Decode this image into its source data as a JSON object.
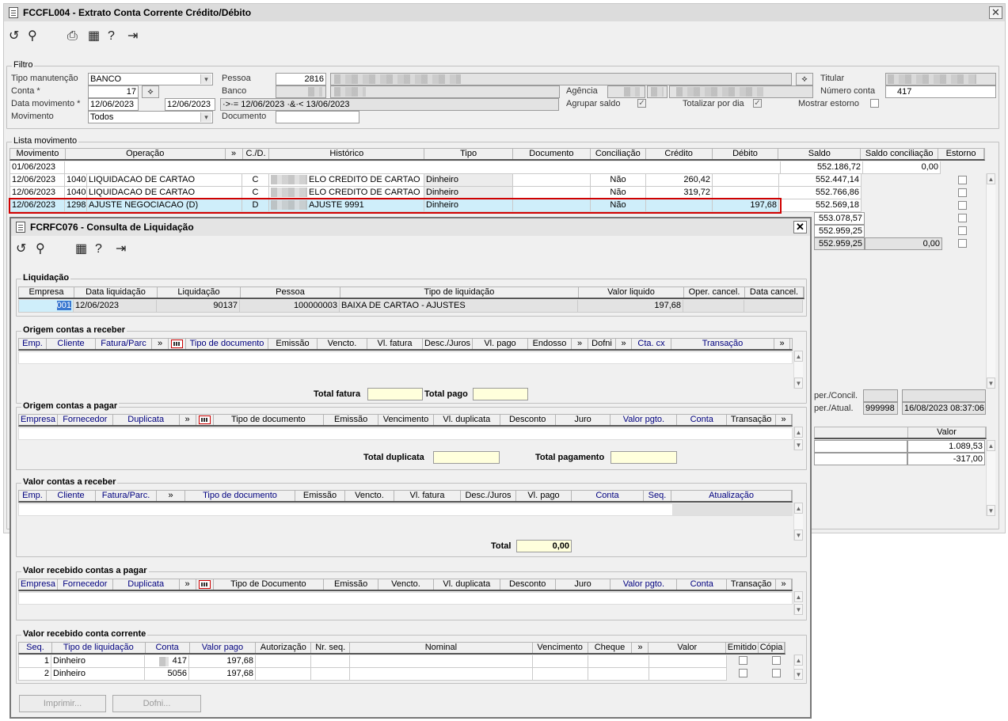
{
  "main_window": {
    "title": "FCCFL004 - Extrato Conta Corrente Crédito/Débito",
    "toolbar": [
      "refresh-icon",
      "search-icon",
      "print-icon",
      "calendar-icon",
      "help-icon",
      "exit-icon"
    ],
    "filtro": {
      "legend": "Filtro",
      "tipo_manutencao_label": "Tipo manutenção",
      "tipo_manutencao_value": "BANCO",
      "conta_label": "Conta *",
      "conta_value": "17",
      "data_mov_label": "Data movimento *",
      "data_ini": "12/06/2023",
      "data_fim": "12/06/2023",
      "data_expr": "·>·= 12/06/2023 ·&·< 13/06/2023",
      "movimento_label": "Movimento",
      "movimento_value": "Todos",
      "pessoa_label": "Pessoa",
      "pessoa_value": "2816",
      "banco_label": "Banco",
      "documento_label": "Documento",
      "agencia_label": "Agência",
      "titular_label": "Titular",
      "numero_conta_label": "Número conta",
      "numero_conta_value": "417",
      "agrupar_saldo_label": "Agrupar saldo",
      "agrupar_saldo_checked": "✓",
      "totalizar_dia_label": "Totalizar por dia",
      "totalizar_dia_checked": "✓",
      "mostrar_estorno_label": "Mostrar estorno"
    },
    "lista": {
      "legend": "Lista movimento",
      "headers": [
        "Movimento",
        "Operação",
        "»",
        "C./D.",
        "Histórico",
        "Tipo",
        "Documento",
        "Conciliação",
        "Crédito",
        "Débito",
        "Saldo",
        "Saldo conciliação",
        "Estorno"
      ],
      "rows": [
        {
          "mov": "01/06/2023",
          "op_cod": "",
          "op": "",
          "cd": "",
          "hist": "",
          "tipo": "",
          "doc": "",
          "conc": "",
          "cred": "",
          "deb": "",
          "saldo": "552.186,72",
          "saldo_conc": "0,00"
        },
        {
          "mov": "12/06/2023",
          "op_cod": "1040",
          "op": "LIQUIDACAO DE CARTAO",
          "cd": "C",
          "hist": "ELO CREDITO DE CARTAO",
          "tipo": "Dinheiro",
          "doc": "",
          "conc": "Não",
          "cred": "260,42",
          "deb": "",
          "saldo": "552.447,14",
          "saldo_conc": ""
        },
        {
          "mov": "12/06/2023",
          "op_cod": "1040",
          "op": "LIQUIDACAO DE CARTAO",
          "cd": "C",
          "hist": "ELO CREDITO DE CARTAO",
          "tipo": "Dinheiro",
          "doc": "",
          "conc": "Não",
          "cred": "319,72",
          "deb": "",
          "saldo": "552.766,86",
          "saldo_conc": ""
        },
        {
          "mov": "12/06/2023",
          "op_cod": "1298",
          "op": "AJUSTE NEGOCIACAO (D)",
          "cd": "D",
          "hist": "AJUSTE 9991",
          "tipo": "Dinheiro",
          "doc": "",
          "conc": "Não",
          "cred": "",
          "deb": "197,68",
          "saldo": "552.569,18",
          "saldo_conc": ""
        }
      ],
      "extra_saldos": [
        "553.078,57",
        "552.959,25",
        "552.959,25"
      ],
      "extra_saldo_conc": "0,00"
    },
    "side": {
      "oper_concil_label": "per./Concil.",
      "oper_atual_label": "per./Atual.",
      "oper_atual_user": "999998",
      "oper_atual_date": "16/08/2023 08:37:06",
      "valor_header": "Valor",
      "valores": [
        "1.089,53",
        "-317,00"
      ]
    }
  },
  "dialog": {
    "title": "FCRFC076 - Consulta de Liquidação",
    "toolbar": [
      "refresh-icon",
      "search-icon",
      "calendar-icon",
      "help-icon",
      "exit-icon"
    ],
    "liquidacao": {
      "legend": "Liquidação",
      "headers": [
        "Empresa",
        "Data liquidação",
        "Liquidação",
        "Pessoa",
        "Tipo de liquidação",
        "Valor liquido",
        "Oper. cancel.",
        "Data cancel."
      ],
      "empresa": "001",
      "data": "12/06/2023",
      "liquidacao": "90137",
      "pessoa": "100000003",
      "tipo": "BAIXA DE CARTAO - AJUSTES",
      "valor": "197,68"
    },
    "origem_receber": {
      "legend": "Origem contas a receber",
      "headers": [
        "Emp.",
        "Cliente",
        "Fatura/Parc",
        "»",
        "",
        "Tipo de documento",
        "Emissão",
        "Vencto.",
        "Vl. fatura",
        "Desc./Juros",
        "Vl. pago",
        "Endosso",
        "»",
        "Dofni",
        "»",
        "Cta. cx",
        "Transação",
        "»"
      ],
      "total_fatura_label": "Total fatura",
      "total_pago_label": "Total pago"
    },
    "origem_pagar": {
      "legend": "Origem contas a pagar",
      "headers": [
        "Empresa",
        "Fornecedor",
        "Duplicata",
        "»",
        "",
        "Tipo de documento",
        "Emissão",
        "Vencimento",
        "Vl. duplicata",
        "Desconto",
        "Juro",
        "Valor pgto.",
        "Conta",
        "Transação",
        "»"
      ],
      "total_duplicata_label": "Total duplicata",
      "total_pagamento_label": "Total pagamento"
    },
    "valor_receber": {
      "legend": "Valor contas a receber",
      "headers": [
        "Emp.",
        "Cliente",
        "Fatura/Parc.",
        "»",
        "Tipo de documento",
        "Emissão",
        "Vencto.",
        "Vl. fatura",
        "Desc./Juros",
        "Vl. pago",
        "Conta",
        "Seq.",
        "Atualização"
      ],
      "total_label": "Total",
      "total_value": "0,00"
    },
    "valor_pagar": {
      "legend": "Valor recebido contas a pagar",
      "headers": [
        "Empresa",
        "Fornecedor",
        "Duplicata",
        "»",
        "",
        "Tipo de Documento",
        "Emissão",
        "Vencto.",
        "Vl. duplicata",
        "Desconto",
        "Juro",
        "Valor pgto.",
        "Conta",
        "Transação",
        "»"
      ]
    },
    "conta_corrente": {
      "legend": "Valor recebido conta corrente",
      "headers": [
        "Seq.",
        "Tipo de liquidação",
        "Conta",
        "Valor pago",
        "Autorização",
        "Nr. seq.",
        "Nominal",
        "Vencimento",
        "Cheque",
        "»",
        "Valor",
        "Emitido",
        "Cópia"
      ],
      "rows": [
        {
          "seq": "1",
          "tipo": "Dinheiro",
          "conta": "417",
          "valor": "197,68"
        },
        {
          "seq": "2",
          "tipo": "Dinheiro",
          "conta": "5056",
          "valor": "197,68"
        }
      ]
    },
    "buttons": {
      "imprimir": "Imprimir...",
      "dofni": "Dofni..."
    }
  }
}
